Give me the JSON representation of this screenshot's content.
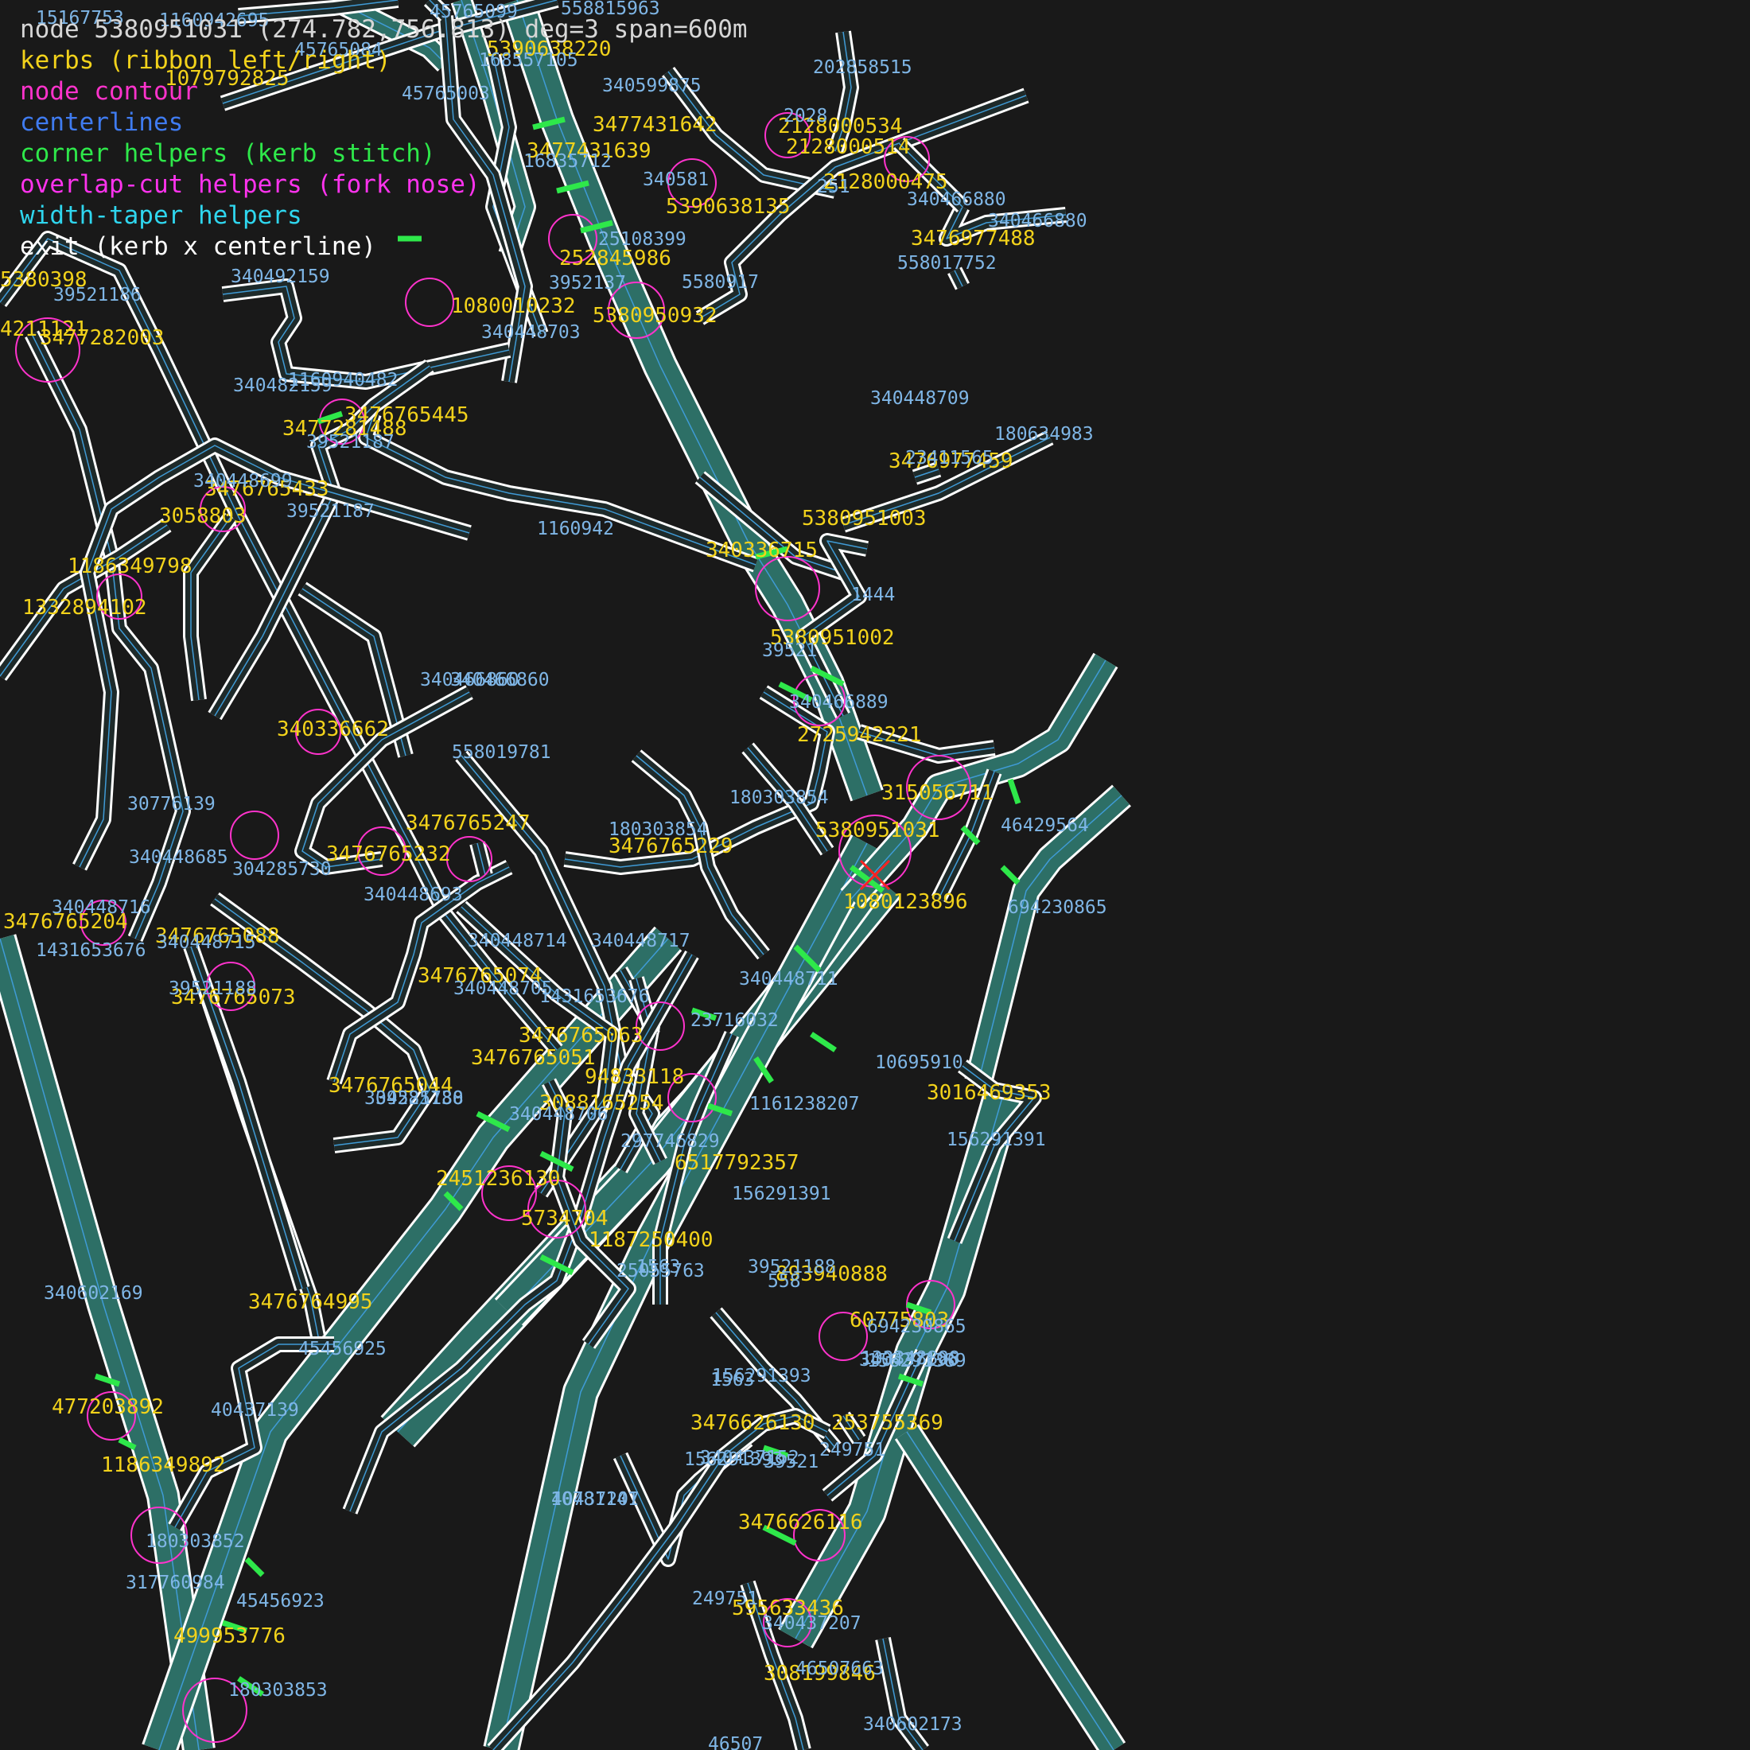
{
  "legend": {
    "header": "node 5380951031 (274.782,756.813) deg=3 span=600m",
    "kerbs": "kerbs (ribbon left/right)",
    "contour": "node contour",
    "centerlines": "centerlines",
    "corner": "corner helpers (kerb stitch)",
    "overlap": "overlap-cut helpers (fork nose)",
    "taper": "width-taper helpers",
    "exit": "exit (kerb x centerline)"
  },
  "colors": {
    "background": "#191919",
    "kerb": "#ffffff",
    "ribbon_fill": "#2d6f66",
    "contour": "#ff33cc",
    "centerline": "#3f9bd6",
    "corner_helper": "#2ee84a",
    "node_label": "#f2d21b",
    "way_label": "#7fb6e6",
    "exit_marker": "#ff2222"
  },
  "node_labels": [
    "5380951031",
    "315056711",
    "2725942221",
    "5380951002",
    "5380951003",
    "340336715",
    "5380950932",
    "5390638135",
    "252845986",
    "3477431639",
    "3477431642",
    "2128000534",
    "2128000514",
    "2128000475",
    "3476977488",
    "3476977459",
    "1080010232",
    "5390638220",
    "1079792825",
    "5380398",
    "3477282003",
    "4211121",
    "3477281488",
    "3476765445",
    "3476765433",
    "3058803",
    "1186349798",
    "1332894102",
    "340336662",
    "3476765247",
    "3476765232",
    "3476765229",
    "3476765074",
    "3476765088",
    "3476765073",
    "3476765063",
    "3476765051",
    "3476765044",
    "3476765204",
    "1080123896",
    "3088165254",
    "94833118",
    "6517792357",
    "2451236130",
    "5734704",
    "1187250400",
    "3016469353",
    "60775803",
    "253755369",
    "3476626130",
    "3476626116",
    "595633436",
    "308199846",
    "477203892",
    "1186349892",
    "499953776",
    "3476764995",
    "893940888"
  ],
  "way_labels": [
    "15167753",
    "1160942695",
    "45765099",
    "558815963",
    "45765084",
    "168557105",
    "45765003",
    "340599875",
    "202858515",
    "2028",
    "16835712",
    "340581",
    "251",
    "340466880",
    "340466880",
    "558017752",
    "25108399",
    "39521186",
    "340492159",
    "340448703",
    "3952137",
    "5580917",
    "340482159",
    "1160940482",
    "39521187",
    "340448699",
    "39521187",
    "1160942",
    "340448709",
    "180634983",
    "23411565",
    "1444",
    "39521",
    "340466889",
    "340466860",
    "340466860",
    "558019781",
    "180303854",
    "180303854",
    "30776139",
    "340448685",
    "304285730",
    "340448693",
    "340448716",
    "1431653676",
    "340448715",
    "39521188",
    "340448714",
    "340448717",
    "1431653676",
    "340448705",
    "304285730",
    "340448706",
    "340448711",
    "23716032",
    "39521188",
    "10695910",
    "1161238207",
    "156291391",
    "297746829",
    "1563",
    "25055763",
    "694230865",
    "133348888",
    "558",
    "156291391",
    "249751",
    "1563",
    "10781141",
    "39521",
    "156291393",
    "156291389",
    "340437196",
    "40437207",
    "340437207",
    "46507663",
    "156291393",
    "249751",
    "340437152",
    "340602173",
    "46507",
    "340602169",
    "40437139",
    "180303852",
    "317760984",
    "45456923",
    "180303853",
    "45456925",
    "46429564",
    "39521188",
    "694230865",
    "156291391",
    "25055763"
  ],
  "exit_marker": "cross"
}
